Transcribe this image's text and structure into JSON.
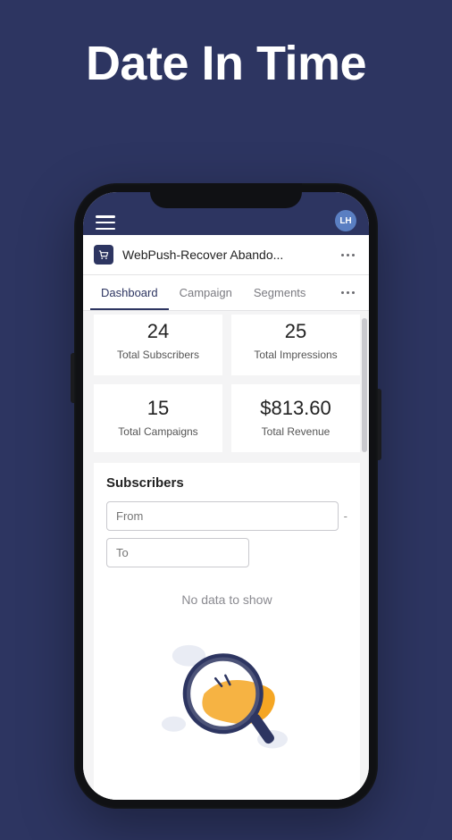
{
  "hero": {
    "title": "Date In Time"
  },
  "topbar": {
    "avatar_initials": "LH"
  },
  "app": {
    "title": "WebPush-Recover Abando..."
  },
  "tabs": {
    "items": [
      {
        "label": "Dashboard",
        "active": true
      },
      {
        "label": "Campaign",
        "active": false
      },
      {
        "label": "Segments",
        "active": false
      }
    ]
  },
  "stats": {
    "total_subscribers": {
      "value": "24",
      "label": "Total Subscribers"
    },
    "total_impressions": {
      "value": "25",
      "label": "Total Impressions"
    },
    "total_campaigns": {
      "value": "15",
      "label": "Total Campaigns"
    },
    "total_revenue": {
      "value": "$813.60",
      "label": "Total Revenue"
    }
  },
  "subscribers_section": {
    "title": "Subscribers",
    "from_placeholder": "From",
    "to_placeholder": "To",
    "range_separator": "-",
    "empty_text": "No data to show"
  },
  "colors": {
    "brand": "#2d3561",
    "accent_orange": "#f5a623"
  }
}
